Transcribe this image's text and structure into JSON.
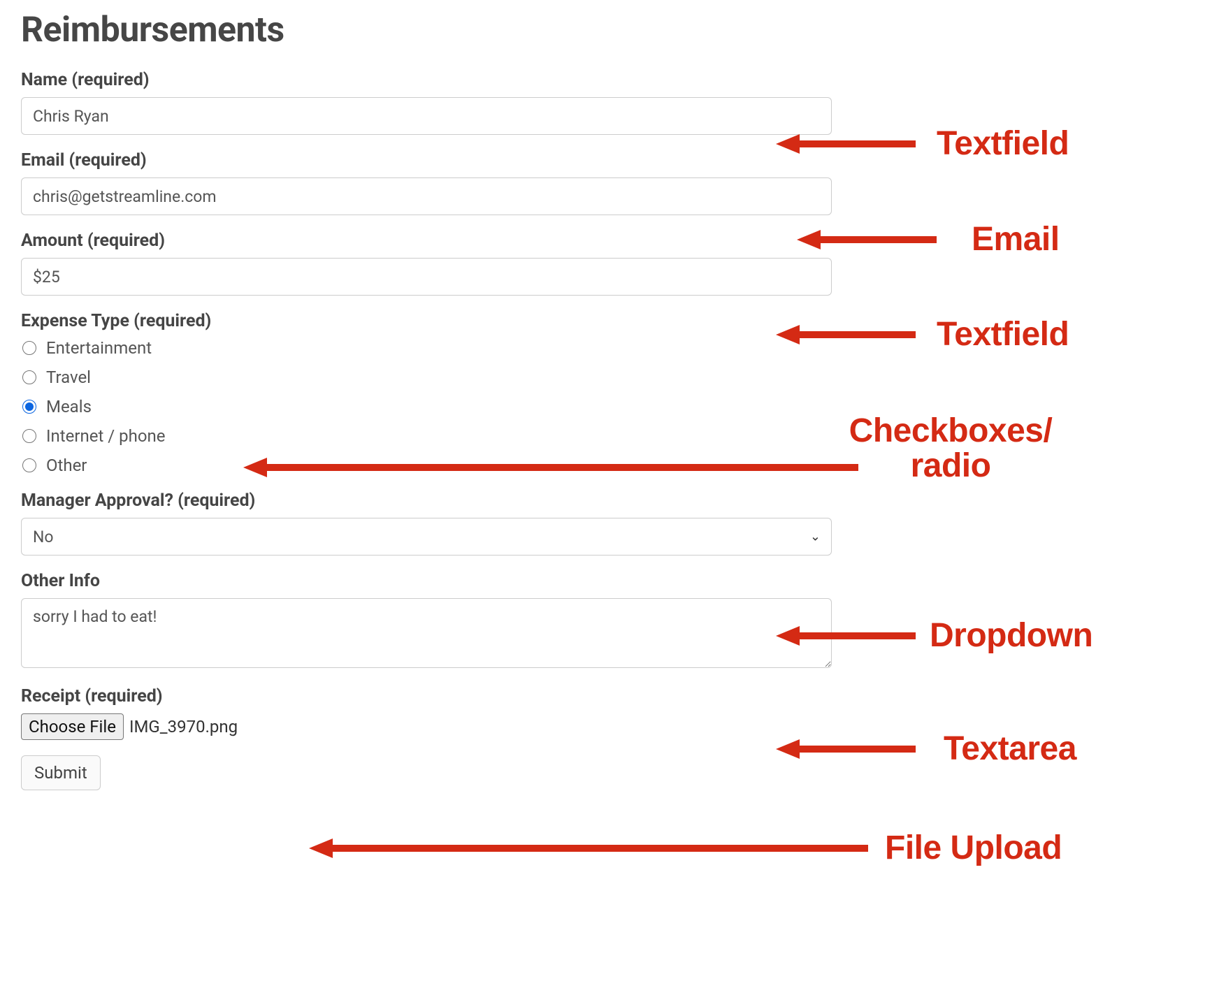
{
  "colors": {
    "annotation": "#d42a14"
  },
  "page": {
    "title": "Reimbursements"
  },
  "fields": {
    "name": {
      "label": "Name (required)",
      "value": "Chris Ryan"
    },
    "email": {
      "label": "Email (required)",
      "value": "chris@getstreamline.com"
    },
    "amount": {
      "label": "Amount (required)",
      "value": "$25"
    },
    "expense_type": {
      "label": "Expense Type (required)",
      "options": [
        "Entertainment",
        "Travel",
        "Meals",
        "Internet / phone",
        "Other"
      ],
      "selected": "Meals"
    },
    "manager_approval": {
      "label": "Manager Approval? (required)",
      "selected": "No"
    },
    "other_info": {
      "label": "Other Info",
      "value": "sorry I had to eat!"
    },
    "receipt": {
      "label": "Receipt (required)",
      "button": "Choose File",
      "filename": "IMG_3970.png"
    },
    "submit": {
      "label": "Submit"
    }
  },
  "annotations": {
    "name": "Textfield",
    "email": "Email",
    "amount": "Textfield",
    "radio_line1": "Checkboxes/",
    "radio_line2": "radio",
    "dropdown": "Dropdown",
    "textarea": "Textarea",
    "file": "File Upload"
  }
}
